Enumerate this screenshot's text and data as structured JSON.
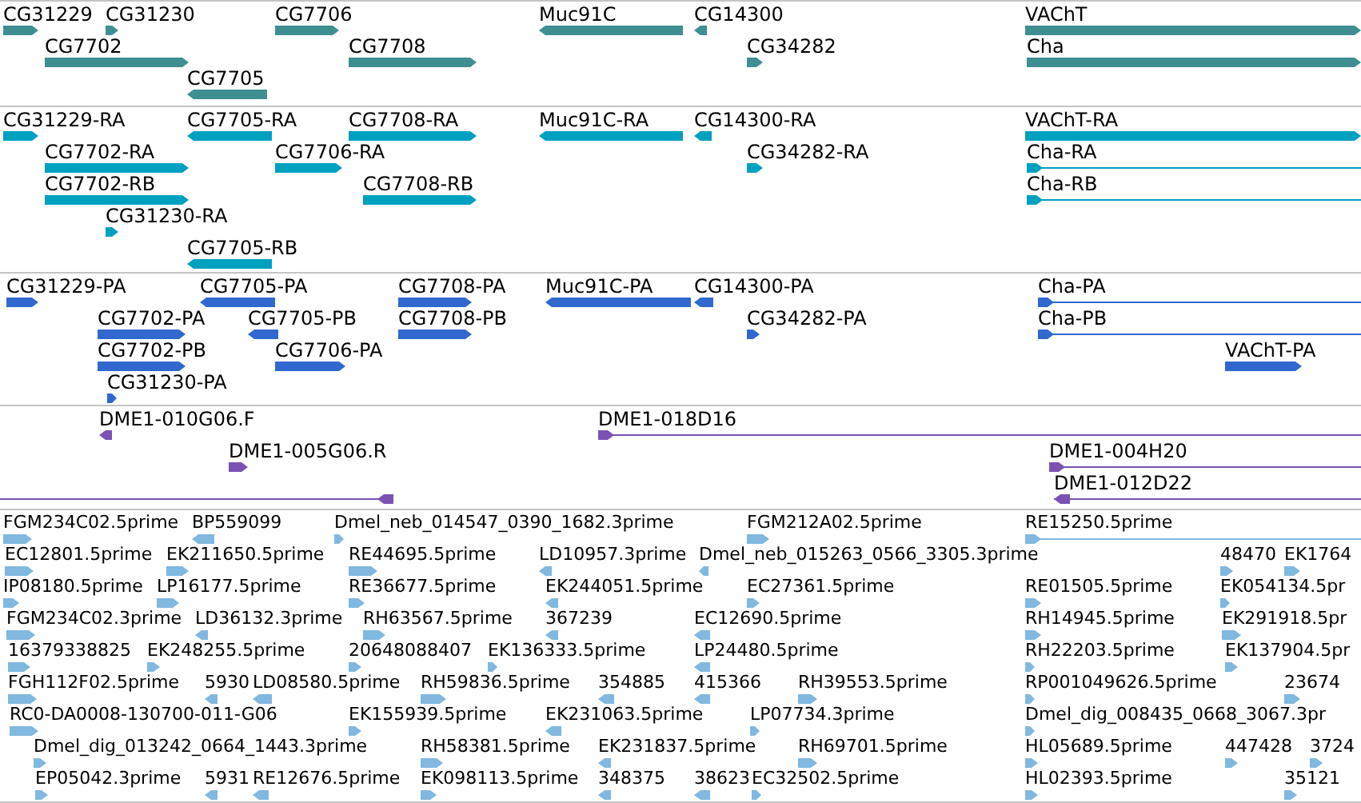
{
  "tracks": [
    {
      "color": "#3f8f92",
      "features": [
        {
          "label": "CG31229",
          "reverse": false
        },
        {
          "label": "CG31230",
          "reverse": false
        },
        {
          "label": "CG7706",
          "reverse": false
        },
        {
          "label": "Muc91C",
          "reverse": true
        },
        {
          "label": "CG14300",
          "reverse": true
        },
        {
          "label": "VAChT",
          "reverse": false
        },
        {
          "label": "CG7702",
          "reverse": false
        },
        {
          "label": "CG7708",
          "reverse": false
        },
        {
          "label": "CG34282",
          "reverse": false
        },
        {
          "label": "Cha",
          "reverse": false
        },
        {
          "label": "CG7705",
          "reverse": true
        }
      ]
    },
    {
      "color": "#00a0c0",
      "features": [
        {
          "label": "CG31229-RA",
          "reverse": false
        },
        {
          "label": "CG7705-RA",
          "reverse": true
        },
        {
          "label": "CG7708-RA",
          "reverse": false
        },
        {
          "label": "Muc91C-RA",
          "reverse": true
        },
        {
          "label": "CG14300-RA",
          "reverse": true
        },
        {
          "label": "VAChT-RA",
          "reverse": false
        },
        {
          "label": "CG7702-RA",
          "reverse": false
        },
        {
          "label": "CG7706-RA",
          "reverse": false
        },
        {
          "label": "CG34282-RA",
          "reverse": false
        },
        {
          "label": "Cha-RA",
          "reverse": false
        },
        {
          "label": "CG7702-RB",
          "reverse": false
        },
        {
          "label": "CG7708-RB",
          "reverse": false
        },
        {
          "label": "Cha-RB",
          "reverse": false
        },
        {
          "label": "CG31230-RA",
          "reverse": false
        },
        {
          "label": "CG7705-RB",
          "reverse": true
        }
      ]
    },
    {
      "color": "#3068d0",
      "features": [
        {
          "label": "CG31229-PA",
          "reverse": false
        },
        {
          "label": "CG7705-PA",
          "reverse": true
        },
        {
          "label": "CG7708-PA",
          "reverse": false
        },
        {
          "label": "Muc91C-PA",
          "reverse": true
        },
        {
          "label": "CG14300-PA",
          "reverse": true
        },
        {
          "label": "Cha-PA",
          "reverse": false
        },
        {
          "label": "CG7702-PA",
          "reverse": false
        },
        {
          "label": "CG7705-PB",
          "reverse": true
        },
        {
          "label": "CG7708-PB",
          "reverse": false
        },
        {
          "label": "CG34282-PA",
          "reverse": false
        },
        {
          "label": "Cha-PB",
          "reverse": false
        },
        {
          "label": "CG7702-PB",
          "reverse": false
        },
        {
          "label": "CG7706-PA",
          "reverse": false
        },
        {
          "label": "VAChT-PA",
          "reverse": false
        },
        {
          "label": "CG31230-PA",
          "reverse": false
        }
      ]
    },
    {
      "color": "#7b52b4",
      "features": [
        {
          "label": "DME1-010G06.F",
          "reverse": true
        },
        {
          "label": "DME1-018D16",
          "reverse": false
        },
        {
          "label": "DME1-005G06.R",
          "reverse": false
        },
        {
          "label": "DME1-004H20",
          "reverse": false
        },
        {
          "reverse": true
        },
        {
          "label": "DME1-012D22",
          "reverse": true
        }
      ]
    },
    {
      "color": "#80b8e0",
      "features": [
        {
          "label": "FGM234C02.5prime",
          "reverse": false
        },
        {
          "label": "BP559099",
          "reverse": true
        },
        {
          "label": "Dmel_neb_014547_0390_1682.3prime",
          "reverse": false
        },
        {
          "label": "FGM212A02.5prime",
          "reverse": false
        },
        {
          "label": "RE15250.5prime",
          "reverse": false
        },
        {
          "label": "EC12801.5prime",
          "reverse": false
        },
        {
          "label": "EK211650.5prime",
          "reverse": false
        },
        {
          "label": "RE44695.5prime",
          "reverse": false
        },
        {
          "label": "LD10957.3prime",
          "reverse": true
        },
        {
          "label": "Dmel_neb_015263_0566_3305.3prime",
          "reverse": true
        },
        {
          "label": "48470",
          "reverse": false
        },
        {
          "label": "EK1764",
          "reverse": false
        },
        {
          "label": "IP08180.5prime",
          "reverse": false
        },
        {
          "label": "LP16177.5prime",
          "reverse": false
        },
        {
          "label": "RE36677.5prime",
          "reverse": false
        },
        {
          "label": "EK244051.5prime",
          "reverse": true
        },
        {
          "label": "EC27361.5prime",
          "reverse": false
        },
        {
          "label": "RE01505.5prime",
          "reverse": false
        },
        {
          "label": "EK054134.5pr",
          "reverse": false
        },
        {
          "label": "FGM234C02.3prime",
          "reverse": false
        },
        {
          "label": "LD36132.3prime",
          "reverse": true
        },
        {
          "label": "RH63567.5prime",
          "reverse": false
        },
        {
          "label": "367239",
          "reverse": true
        },
        {
          "label": "EC12690.5prime",
          "reverse": true
        },
        {
          "label": "RH14945.5prime",
          "reverse": false
        },
        {
          "label": "EK291918.5pr",
          "reverse": false
        },
        {
          "label": "16379338825",
          "reverse": false
        },
        {
          "label": "EK248255.5prime",
          "reverse": false
        },
        {
          "label": "20648088407",
          "reverse": false
        },
        {
          "label": "EK136333.5prime",
          "reverse": false
        },
        {
          "label": "LP24480.5prime",
          "reverse": true
        },
        {
          "label": "RH22203.5prime",
          "reverse": false
        },
        {
          "label": "EK137904.5pr",
          "reverse": false
        },
        {
          "label": "FGH112F02.5prime",
          "reverse": false
        },
        {
          "label": "5930",
          "reverse": true
        },
        {
          "label": "LD08580.5prime",
          "reverse": true
        },
        {
          "label": "RH59836.5prime",
          "reverse": false
        },
        {
          "label": "354885",
          "reverse": true
        },
        {
          "label": "415366",
          "reverse": true
        },
        {
          "label": "RH39553.5prime",
          "reverse": false
        },
        {
          "label": "RP001049626.5prime",
          "reverse": false
        },
        {
          "label": "23674",
          "reverse": false
        },
        {
          "label": "RC0-DA0008-130700-011-G06",
          "reverse": false
        },
        {
          "label": "EK155939.5prime",
          "reverse": false
        },
        {
          "label": "EK231063.5prime",
          "reverse": true
        },
        {
          "label": "LP07734.3prime",
          "reverse": false
        },
        {
          "label": "Dmel_dig_008435_0668_3067.3pr",
          "reverse": false
        },
        {
          "label": "Dmel_dig_013242_0664_1443.3prime",
          "reverse": false
        },
        {
          "label": "RH58381.5prime",
          "reverse": false
        },
        {
          "label": "EK231837.5prime",
          "reverse": true
        },
        {
          "label": "RH69701.5prime",
          "reverse": false
        },
        {
          "label": "HL05689.5prime",
          "reverse": false
        },
        {
          "label": "447428",
          "reverse": false
        },
        {
          "label": "3724",
          "reverse": false
        },
        {
          "label": "EP05042.3prime",
          "reverse": false
        },
        {
          "label": "5931",
          "reverse": true
        },
        {
          "label": "RE12676.5prime",
          "reverse": true
        },
        {
          "label": "EK098113.5prime",
          "reverse": false
        },
        {
          "label": "348375",
          "reverse": true
        },
        {
          "label": "38623",
          "reverse": true
        },
        {
          "label": "EC32502.5prime",
          "reverse": false
        },
        {
          "label": "HL02393.5prime",
          "reverse": false
        },
        {
          "label": "35121",
          "reverse": false
        }
      ]
    }
  ]
}
